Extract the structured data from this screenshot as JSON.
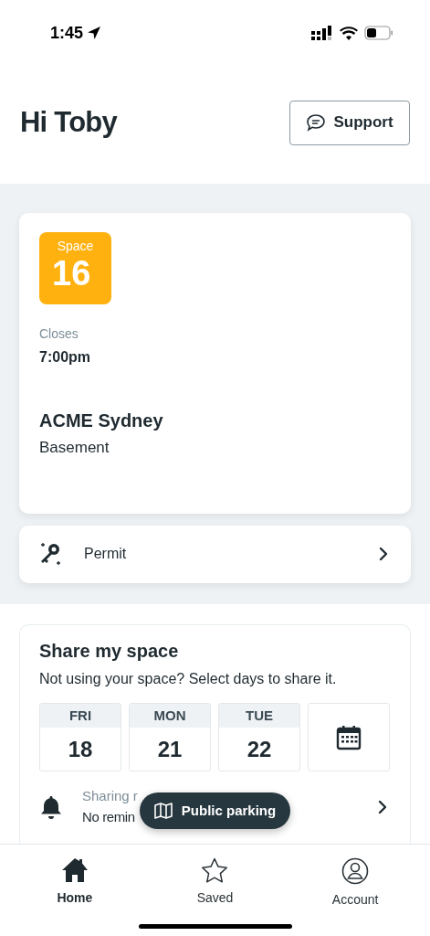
{
  "status_bar": {
    "time": "1:45"
  },
  "header": {
    "greeting": "Hi Toby",
    "support_button": "Support"
  },
  "space_card": {
    "badge_label": "Space",
    "badge_number": "16",
    "closes_label": "Closes",
    "closes_time": "7:00pm",
    "location": "ACME Sydney",
    "level": "Basement"
  },
  "permit_row": {
    "label": "Permit"
  },
  "share": {
    "title": "Share my space",
    "subtitle": "Not using your space? Select days to share it.",
    "days": [
      {
        "weekday": "FRI",
        "date": "18"
      },
      {
        "weekday": "MON",
        "date": "21"
      },
      {
        "weekday": "TUE",
        "date": "22"
      }
    ],
    "reminder": {
      "label": "Sharing r",
      "value": "No remin"
    }
  },
  "floating_button": "Public parking",
  "tabs": [
    {
      "label": "Home",
      "selected": true,
      "kind": "home"
    },
    {
      "label": "Saved",
      "selected": false,
      "kind": "saved"
    },
    {
      "label": "Account",
      "selected": false,
      "kind": "account"
    }
  ]
}
